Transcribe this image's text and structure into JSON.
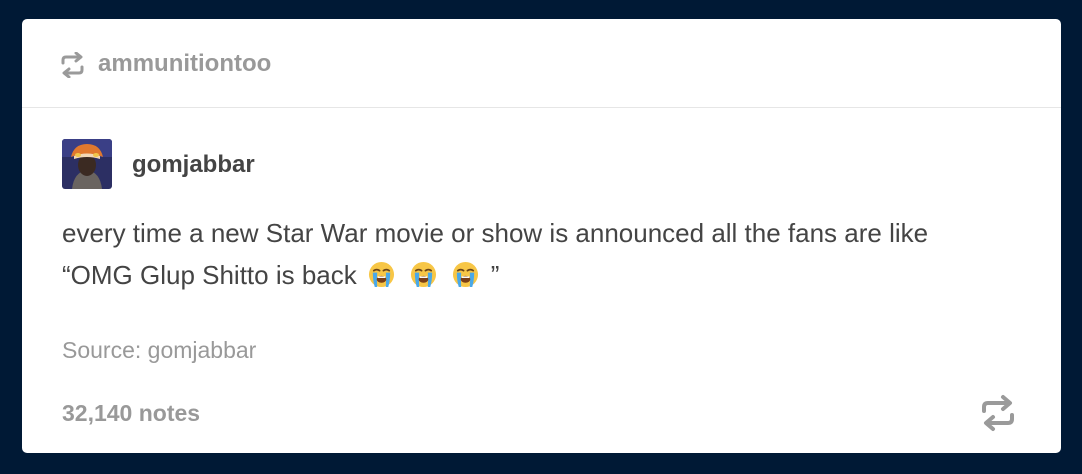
{
  "reblog_header": {
    "icon": "reblog-icon",
    "username": "ammunitiontoo"
  },
  "author": {
    "username": "gomjabbar",
    "avatar": "avatar"
  },
  "post": {
    "line1": "every time a new Star War movie or show is announced all the fans are like",
    "line2_start": "“OMG Glup Shitto is back",
    "emoji": "crying-face-icon",
    "emoji_count": 3,
    "line2_end": "”"
  },
  "source": {
    "text": "Source: gomjabbar"
  },
  "footer": {
    "notes": "32,140 notes",
    "reblog_icon": "reblog-icon"
  },
  "colors": {
    "background": "#001935",
    "card": "#ffffff",
    "muted_text": "#999999",
    "body_text": "#444444"
  }
}
